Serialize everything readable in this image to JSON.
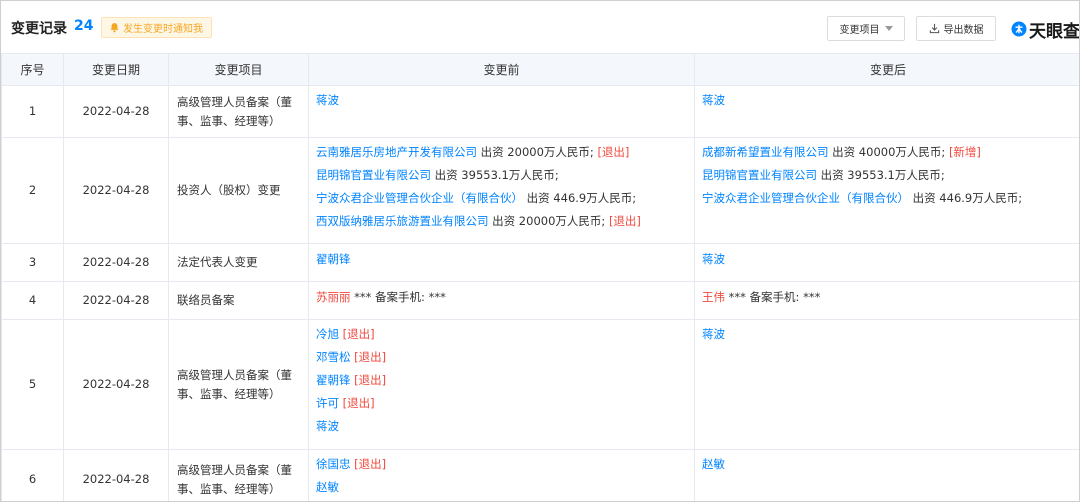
{
  "header": {
    "title": "变更记录",
    "count": "24",
    "notify_label": "发生变更时通知我",
    "filter_label": "变更项目",
    "export_label": "导出数据",
    "brand": "天眼查"
  },
  "table": {
    "columns": [
      "序号",
      "变更日期",
      "变更项目",
      "变更前",
      "变更后"
    ],
    "rows": [
      {
        "index": "1",
        "date": "2022-04-28",
        "item": "高级管理人员备案（董事、监事、经理等）",
        "before": [
          {
            "link": "蒋波",
            "text": "",
            "tag": ""
          }
        ],
        "after": [
          {
            "link": "蒋波",
            "text": "",
            "tag": ""
          }
        ]
      },
      {
        "index": "2",
        "date": "2022-04-28",
        "item": "投资人（股权）变更",
        "before": [
          {
            "link": "云南雅居乐房地产开发有限公司",
            "text": " 出资 20000万人民币; ",
            "tag": "[退出]"
          },
          {
            "link": "昆明锦官置业有限公司",
            "text": " 出资 39553.1万人民币;",
            "tag": ""
          },
          {
            "link": "宁波众君企业管理合伙企业（有限合伙）",
            "text": " 出资 446.9万人民币;",
            "tag": ""
          },
          {
            "link": "西双版纳雅居乐旅游置业有限公司",
            "text": " 出资 20000万人民币; ",
            "tag": "[退出]"
          }
        ],
        "after": [
          {
            "link": "成都新希望置业有限公司",
            "text": " 出资 40000万人民币; ",
            "tag": "[新增]"
          },
          {
            "link": "昆明锦官置业有限公司",
            "text": " 出资 39553.1万人民币;",
            "tag": ""
          },
          {
            "link": "宁波众君企业管理合伙企业（有限合伙）",
            "text": " 出资 446.9万人民币;",
            "tag": ""
          }
        ]
      },
      {
        "index": "3",
        "date": "2022-04-28",
        "item": "法定代表人变更",
        "before": [
          {
            "link": "翟朝锋",
            "text": "",
            "tag": ""
          }
        ],
        "after": [
          {
            "link": "蒋波",
            "text": "",
            "tag": ""
          }
        ]
      },
      {
        "index": "4",
        "date": "2022-04-28",
        "item": "联络员备案",
        "before": [
          {
            "name": "苏丽丽",
            "text": " *** 备案手机: ***"
          }
        ],
        "after": [
          {
            "name": "王伟",
            "text": " *** 备案手机: ***"
          }
        ]
      },
      {
        "index": "5",
        "date": "2022-04-28",
        "item": "高级管理人员备案（董事、监事、经理等）",
        "before": [
          {
            "link": "冷旭",
            "text": " ",
            "tag": "[退出]"
          },
          {
            "link": "邓雪松",
            "text": " ",
            "tag": "[退出]"
          },
          {
            "link": "翟朝锋",
            "text": " ",
            "tag": "[退出]"
          },
          {
            "link": "许可",
            "text": " ",
            "tag": "[退出]"
          },
          {
            "link": "蒋波",
            "text": "",
            "tag": ""
          }
        ],
        "after": [
          {
            "link": "蒋波",
            "text": "",
            "tag": ""
          }
        ]
      },
      {
        "index": "6",
        "date": "2022-04-28",
        "item": "高级管理人员备案（董事、监事、经理等）",
        "before": [
          {
            "link": "徐国忠",
            "text": " ",
            "tag": "[退出]"
          },
          {
            "link": "赵敏",
            "text": "",
            "tag": ""
          }
        ],
        "after": [
          {
            "link": "赵敏",
            "text": "",
            "tag": ""
          }
        ]
      }
    ]
  },
  "colors": {
    "link": "#0084ff",
    "exit_tag": "#f04a3e",
    "header_bg": "#f4f7fc",
    "brand_blue": "#0084ff"
  },
  "icons": {
    "notify": "bell-icon",
    "filter": "caret-down-icon",
    "export": "download-icon",
    "brand": "tianyancha-logo-icon"
  }
}
